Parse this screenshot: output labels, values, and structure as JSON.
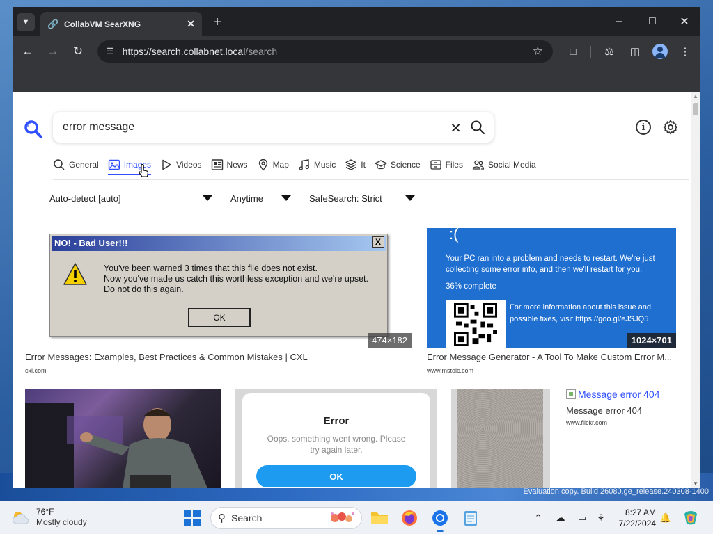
{
  "window": {
    "tab_title": "CollabVM SearXNG",
    "url_host": "https://search.collabnet.local",
    "url_path": "/search"
  },
  "search": {
    "query": "error message"
  },
  "categories": [
    {
      "label": "General",
      "icon": "magnifier-icon"
    },
    {
      "label": "Images",
      "icon": "image-icon",
      "active": true
    },
    {
      "label": "Videos",
      "icon": "play-icon"
    },
    {
      "label": "News",
      "icon": "newspaper-icon"
    },
    {
      "label": "Map",
      "icon": "map-pin-icon"
    },
    {
      "label": "Music",
      "icon": "music-note-icon"
    },
    {
      "label": "It",
      "icon": "layers-icon"
    },
    {
      "label": "Science",
      "icon": "graduation-cap-icon"
    },
    {
      "label": "Files",
      "icon": "file-drawer-icon"
    },
    {
      "label": "Social Media",
      "icon": "people-icon"
    }
  ],
  "filters": {
    "language": "Auto-detect [auto]",
    "time": "Anytime",
    "safesearch": "SafeSearch: Strict"
  },
  "results": [
    {
      "title": "Error Messages: Examples, Best Practices & Common Mistakes | CXL",
      "source": "cxl.com",
      "resolution": "474×182",
      "dialog": {
        "title": "NO! - Bad User!!!",
        "close": "X",
        "line1": "You've been warned 3 times that this file does not exist.",
        "line2": "Now you've made us catch this worthless exception and we're upset.",
        "line3": "Do not do this again.",
        "ok": "OK"
      }
    },
    {
      "title": "Error Message Generator - A Tool To Make Custom Error M...",
      "source": "www.mstoic.com",
      "resolution": "1024×701",
      "bsod": {
        "face": ":(",
        "text": "Your PC ran into a problem and needs to restart. We're just collecting some error info, and then we'll restart for you.",
        "percent": "36% complete",
        "info": "For more information about this issue and possible fixes, visit https://goo.gl/eJSJQ5"
      }
    },
    {
      "phone": {
        "title": "Error",
        "message": "Oops, something went wrong. Please try again later.",
        "ok": "OK"
      }
    },
    {
      "alt": "Message error 404",
      "title": "Message error 404",
      "source": "www.flickr.com"
    }
  ],
  "desktop": {
    "watermark": "Evaluation copy. Build 26080.ge_release.240308-1400"
  },
  "taskbar": {
    "temperature": "76°F",
    "condition": "Mostly cloudy",
    "search_label": "Search",
    "time": "8:27 AM",
    "date": "7/22/2024"
  }
}
